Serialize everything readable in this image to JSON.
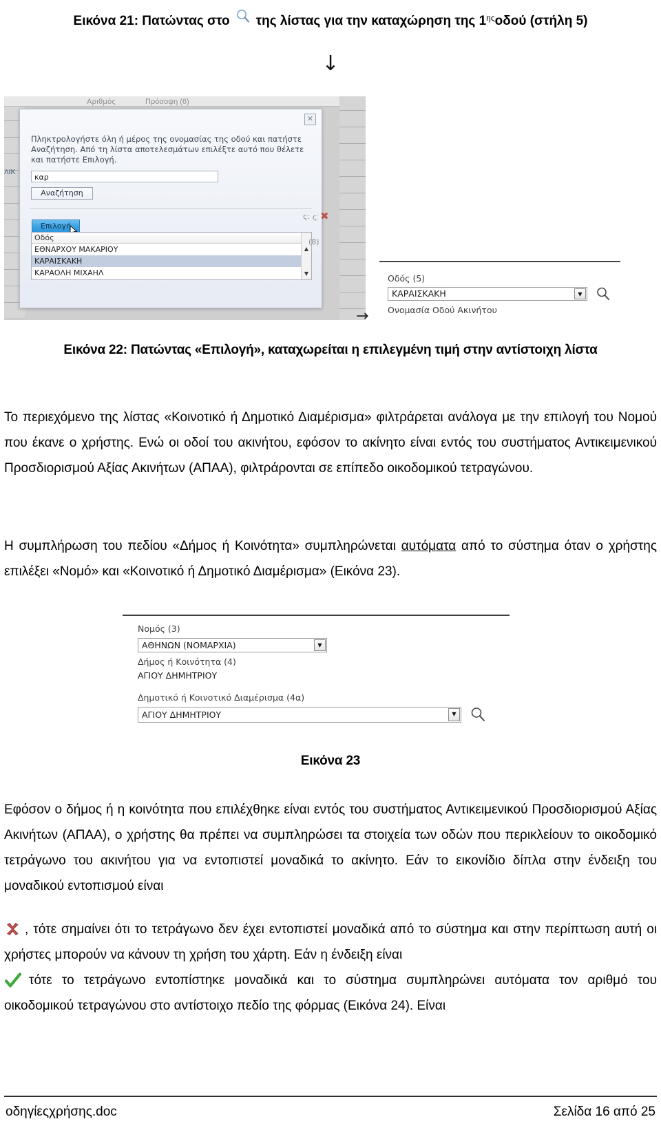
{
  "caption_21": {
    "prefix": "Εικόνα 21: Πατώντας στο",
    "icon": "search-icon",
    "mid": "της λίστας για την καταχώρηση της 1",
    "sup": "ης",
    "suffix": " οδού (στήλη 5)"
  },
  "arrow_down": "↓",
  "figure_21": {
    "grid_header_1": "Αριθμός",
    "grid_header_2": "Πρόσοψη (6)",
    "side_text": "ΛΙΚ",
    "side_label_1": "ς:",
    "side_label_2": "(8)",
    "dialog": {
      "close_icon": "✕",
      "instructions": "Πληκτρολογήστε όλη ή μέρος της ονομασίας της οδού και πατήστε Αναζήτηση. Από τη λίστα αποτελεσμάτων επιλέξτε αυτό που θέλετε και πατήστε Επιλογή.",
      "search_value": "καρ",
      "search_button": "Αναζήτηση",
      "select_button": "Επιλογή",
      "results_header": "Οδός",
      "results": [
        "ΕΘΝΑΡΧΟΥ ΜΑΚΑΡΙΟΥ",
        "ΚΑΡΑΙΣΚΑΚΗ",
        "ΚΑΡΑΟΛΗ ΜΙΧΑΗΛ"
      ],
      "selected_index": 1,
      "scroll_up": "▲",
      "scroll_down": "▼"
    },
    "right_panel": {
      "transition_arrow": "→",
      "street_label": "Οδός (5)",
      "street_value": "ΚΑΡΑΙΣΚΑΚΗ",
      "street_name_label": "Ονομασία Οδού Ακινήτου",
      "dropdown_arrow": "▼",
      "magnifier_icon": "search-icon"
    }
  },
  "caption_22": "Εικόνα 22: Πατώντας «Επιλογή», καταχωρείται η επιλεγμένη τιμή στην αντίστοιχη λίστα",
  "paragraph_1": "Το περιεχόμενο της λίστας «Κοινοτικό ή Δημοτικό Διαμέρισμα» φιλτράρεται ανάλογα με την επιλογή του Νομού που έκανε ο χρήστης. Ενώ οι οδοί του ακινήτου, εφόσον το ακίνητο είναι εντός του συστήματος Αντικειμενικού Προσδιορισμού Αξίας Ακινήτων (ΑΠΑΑ), φιλτράρονται σε επίπεδο οικοδομικού τετραγώνου.",
  "paragraph_2": {
    "before": "Η συμπλήρωση του πεδίου «Δήμος ή Κοινότητα» συμπληρώνεται ",
    "underlined": "αυτόματα",
    "after": " από το σύστημα όταν ο χρήστης επιλέξει «Νομό» και «Κοινοτικό ή Δημοτικό Διαμέρισμα» (Εικόνα 23)."
  },
  "figure_23": {
    "nomos_label": "Νομός (3)",
    "nomos_value": "ΑΘΗΝΩΝ (ΝΟΜΑΡΧΙΑ)",
    "dimos_label": "Δήμος ή Κοινότητα (4)",
    "dimos_value": "ΑΓΙΟΥ ΔΗΜΗΤΡΙΟΥ",
    "diamerisma_label": "Δημοτικό ή Κοινοτικό Διαμέρισμα (4α)",
    "diamerisma_value": "ΑΓΙΟΥ ΔΗΜΗΤΡΙΟΥ",
    "dropdown_arrow": "▼",
    "magnifier_icon": "search-icon"
  },
  "caption_23": "Εικόνα 23",
  "paragraph_3": {
    "part1": "Εφόσον ο δήμος ή η κοινότητα που επιλέχθηκε είναι εντός του συστήματος Αντικειμενικού Προσδιορισμού Αξίας Ακινήτων (ΑΠΑΑ), ο χρήστης θα πρέπει να συμπληρώσει τα στοιχεία των οδών που περικλείουν το οικοδομικό τετράγωνο του ακινήτου για να εντοπιστεί μοναδικά το ακίνητο. Εάν το εικονίδιο δίπλα στην ένδειξη του μοναδικού εντοπισμού είναι",
    "icon_redx": "red-x-icon",
    "part2": ", τότε σημαίνει ότι το τετράγωνο δεν έχει εντοπιστεί μοναδικά από το σύστημα και στην περίπτωση αυτή οι χρήστες μπορούν να κάνουν τη χρήση του χάρτη. Εάν η ένδειξη είναι",
    "icon_check": "green-check-icon",
    "part3": "τότε το τετράγωνο εντοπίστηκε μοναδικά και το σύστημα συμπληρώνει αυτόματα τον αριθμό του οικοδομικού τετραγώνου στο αντίστοιχο πεδίο της φόρμας (Εικόνα 24). Είναι"
  },
  "footer": {
    "left": "οδηγίεςχρήσης.doc",
    "right": "Σελίδα 16 από 25"
  },
  "colors": {
    "accent_blue": "#3fa4e4",
    "selection_row": "#c3cde0",
    "red_x": "#c0504d",
    "green_check": "#3faa3f"
  }
}
